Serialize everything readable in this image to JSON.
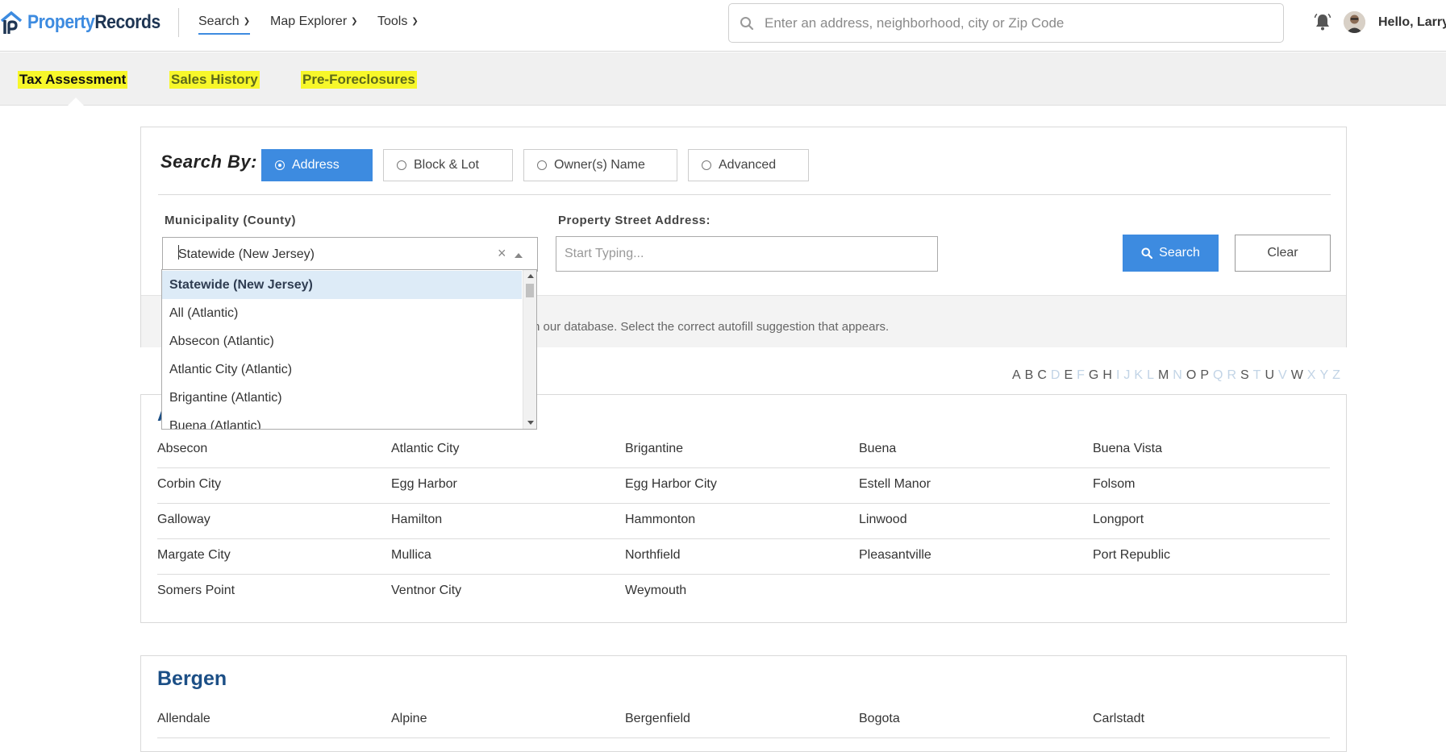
{
  "brand": {
    "part1": "Property",
    "part2": "Records"
  },
  "nav": {
    "items": [
      {
        "label": "Search"
      },
      {
        "label": "Map Explorer"
      },
      {
        "label": "Tools"
      }
    ],
    "search_placeholder": "Enter an address, neighborhood, city or Zip Code",
    "greeting": "Hello, Larry"
  },
  "subtabs": [
    {
      "label": "Tax Assessment"
    },
    {
      "label": "Sales History"
    },
    {
      "label": "Pre-Foreclosures"
    }
  ],
  "search_panel": {
    "search_by_label": "Search By:",
    "options": [
      {
        "label": "Address"
      },
      {
        "label": "Block & Lot"
      },
      {
        "label": "Owner(s) Name"
      },
      {
        "label": "Advanced"
      }
    ],
    "municipality_label": "Municipality (County)",
    "municipality_value": "Statewide (New Jersey)",
    "street_label": "Property Street Address:",
    "street_placeholder": "Start Typing...",
    "search_button": "Search",
    "clear_button": "Clear",
    "hint": "n our database. Select the correct autofill suggestion that appears."
  },
  "dropdown": {
    "items": [
      {
        "label": "Statewide (New Jersey)"
      },
      {
        "label": "All (Atlantic)"
      },
      {
        "label": "Absecon (Atlantic)"
      },
      {
        "label": "Atlantic City (Atlantic)"
      },
      {
        "label": "Brigantine (Atlantic)"
      },
      {
        "label": "Buena (Atlantic)"
      }
    ]
  },
  "alphabet": [
    {
      "letter": "A",
      "active": true
    },
    {
      "letter": "B",
      "active": true
    },
    {
      "letter": "C",
      "active": true
    },
    {
      "letter": "D",
      "active": false
    },
    {
      "letter": "E",
      "active": true
    },
    {
      "letter": "F",
      "active": false
    },
    {
      "letter": "G",
      "active": true
    },
    {
      "letter": "H",
      "active": true
    },
    {
      "letter": "I",
      "active": false
    },
    {
      "letter": "J",
      "active": false
    },
    {
      "letter": "K",
      "active": false
    },
    {
      "letter": "L",
      "active": false
    },
    {
      "letter": "M",
      "active": true
    },
    {
      "letter": "N",
      "active": false
    },
    {
      "letter": "O",
      "active": true
    },
    {
      "letter": "P",
      "active": true
    },
    {
      "letter": "Q",
      "active": false
    },
    {
      "letter": "R",
      "active": false
    },
    {
      "letter": "S",
      "active": true
    },
    {
      "letter": "T",
      "active": false
    },
    {
      "letter": "U",
      "active": true
    },
    {
      "letter": "V",
      "active": false
    },
    {
      "letter": "W",
      "active": true
    },
    {
      "letter": "X",
      "active": false
    },
    {
      "letter": "Y",
      "active": false
    },
    {
      "letter": "Z",
      "active": false
    }
  ],
  "counties": [
    {
      "name": "A",
      "rows": [
        [
          "Absecon",
          "Atlantic City",
          "Brigantine",
          "Buena",
          "Buena Vista"
        ],
        [
          "Corbin City",
          "Egg Harbor",
          "Egg Harbor City",
          "Estell Manor",
          "Folsom"
        ],
        [
          "Galloway",
          "Hamilton",
          "Hammonton",
          "Linwood",
          "Longport"
        ],
        [
          "Margate City",
          "Mullica",
          "Northfield",
          "Pleasantville",
          "Port Republic"
        ],
        [
          "Somers Point",
          "Ventnor City",
          "Weymouth",
          "",
          ""
        ]
      ]
    },
    {
      "name": "Bergen",
      "rows": [
        [
          "Allendale",
          "Alpine",
          "Bergenfield",
          "Bogota",
          "Carlstadt"
        ]
      ]
    }
  ],
  "colors": {
    "accent": "#3d8be0",
    "highlight": "#f7f72a",
    "county_title": "#1c4f86"
  }
}
